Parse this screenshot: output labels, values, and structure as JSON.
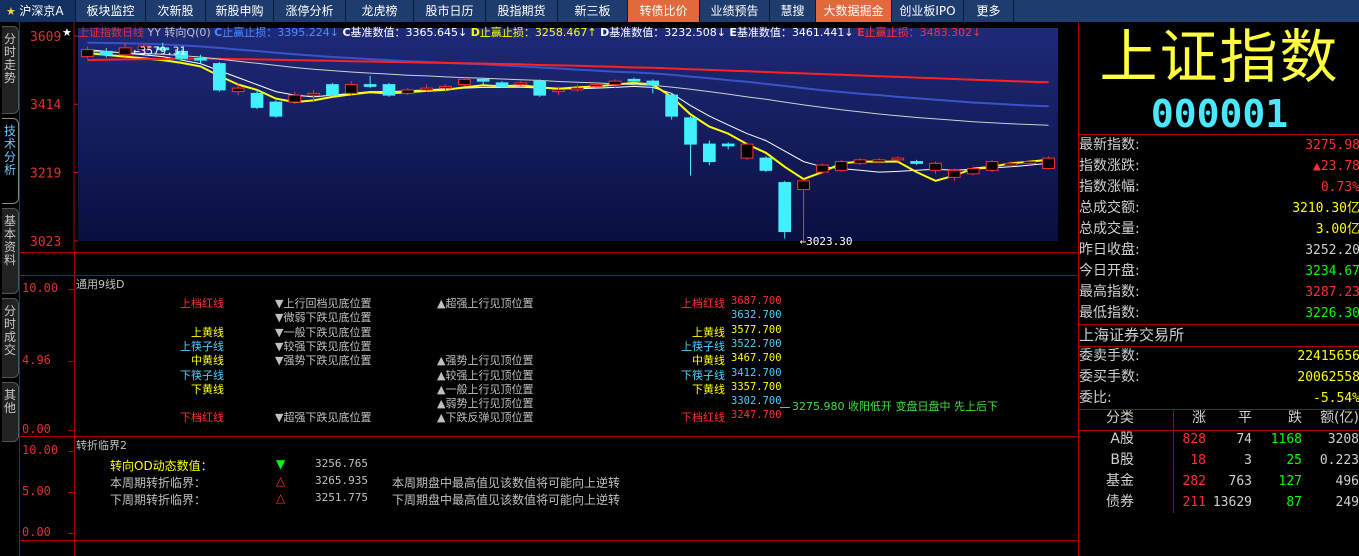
{
  "nav": {
    "tabs": [
      {
        "label": "沪深京A",
        "style": "home"
      },
      {
        "label": "板块监控",
        "style": "normal"
      },
      {
        "label": "次新股",
        "style": "normal"
      },
      {
        "label": "新股申购",
        "style": "normal"
      },
      {
        "label": "涨停分析",
        "style": "normal"
      },
      {
        "label": "龙虎榜",
        "style": "normal"
      },
      {
        "label": "股市日历",
        "style": "normal"
      },
      {
        "label": "股指期货",
        "style": "normal"
      },
      {
        "label": "新三板",
        "style": "normal"
      },
      {
        "label": "转债比价",
        "style": "orange"
      },
      {
        "label": "业绩预告",
        "style": "normal"
      },
      {
        "label": "慧搜",
        "style": "normal"
      },
      {
        "label": "大数据掘金",
        "style": "orange"
      },
      {
        "label": "创业板IPO",
        "style": "normal"
      },
      {
        "label": "更多",
        "style": "normal"
      }
    ]
  },
  "side_tabs": [
    {
      "label": "分时走势",
      "active": false
    },
    {
      "label": "技术分析",
      "active": true
    },
    {
      "label": "基本资料",
      "active": false
    },
    {
      "label": "分时成交",
      "active": false
    },
    {
      "label": "其他",
      "active": false
    }
  ],
  "chart_header": {
    "title": "上证指数日线",
    "mode": "YY 转向Q(0)",
    "items": [
      {
        "key": "C",
        "label": "止赢止损：",
        "value": "3395.224↓",
        "color": "#4a8cff"
      },
      {
        "key": "C",
        "label": "基准数值：",
        "value": "3365.645↓",
        "color": "#ffffff"
      },
      {
        "key": "D",
        "label": "止赢止损：",
        "value": "3258.467↑",
        "color": "#ffff00"
      },
      {
        "key": "D",
        "label": "基准数值：",
        "value": "3232.508↓",
        "color": "#ffffff"
      },
      {
        "key": "E",
        "label": "基准数值：",
        "value": "3461.441↓",
        "color": "#ffffff"
      },
      {
        "key": "E",
        "label": "止赢止损：",
        "value": "3483.302↓",
        "color": "#ff3030"
      }
    ]
  },
  "price_axis": [
    "3609",
    "3414",
    "3219",
    "3023"
  ],
  "annotations": {
    "high": "3579.31",
    "low": "3023.30"
  },
  "chart_data": {
    "type": "candlestick",
    "ylim": [
      3023,
      3609
    ],
    "candles": [
      {
        "o": 3550,
        "c": 3570,
        "h": 3579,
        "l": 3545
      },
      {
        "o": 3565,
        "c": 3555,
        "h": 3575,
        "l": 3548
      },
      {
        "o": 3555,
        "c": 3575,
        "h": 3590,
        "l": 3550
      },
      {
        "o": 3570,
        "c": 3580,
        "h": 3585,
        "l": 3560
      },
      {
        "o": 3575,
        "c": 3570,
        "h": 3590,
        "l": 3565
      },
      {
        "o": 3565,
        "c": 3545,
        "h": 3570,
        "l": 3540
      },
      {
        "o": 3545,
        "c": 3540,
        "h": 3555,
        "l": 3530
      },
      {
        "o": 3530,
        "c": 3455,
        "h": 3535,
        "l": 3450
      },
      {
        "o": 3450,
        "c": 3460,
        "h": 3475,
        "l": 3440
      },
      {
        "o": 3445,
        "c": 3405,
        "h": 3455,
        "l": 3400
      },
      {
        "o": 3420,
        "c": 3380,
        "h": 3425,
        "l": 3375
      },
      {
        "o": 3420,
        "c": 3440,
        "h": 3450,
        "l": 3415
      },
      {
        "o": 3440,
        "c": 3445,
        "h": 3455,
        "l": 3420
      },
      {
        "o": 3470,
        "c": 3440,
        "h": 3475,
        "l": 3435
      },
      {
        "o": 3445,
        "c": 3470,
        "h": 3480,
        "l": 3440
      },
      {
        "o": 3470,
        "c": 3465,
        "h": 3495,
        "l": 3460
      },
      {
        "o": 3470,
        "c": 3440,
        "h": 3475,
        "l": 3435
      },
      {
        "o": 3445,
        "c": 3455,
        "h": 3460,
        "l": 3440
      },
      {
        "o": 3455,
        "c": 3460,
        "h": 3470,
        "l": 3450
      },
      {
        "o": 3460,
        "c": 3465,
        "h": 3470,
        "l": 3450
      },
      {
        "o": 3470,
        "c": 3485,
        "h": 3490,
        "l": 3465
      },
      {
        "o": 3485,
        "c": 3480,
        "h": 3490,
        "l": 3470
      },
      {
        "o": 3475,
        "c": 3465,
        "h": 3480,
        "l": 3460
      },
      {
        "o": 3470,
        "c": 3475,
        "h": 3480,
        "l": 3465
      },
      {
        "o": 3480,
        "c": 3440,
        "h": 3485,
        "l": 3435
      },
      {
        "o": 3450,
        "c": 3455,
        "h": 3465,
        "l": 3440
      },
      {
        "o": 3455,
        "c": 3460,
        "h": 3470,
        "l": 3450
      },
      {
        "o": 3465,
        "c": 3470,
        "h": 3475,
        "l": 3460
      },
      {
        "o": 3470,
        "c": 3480,
        "h": 3485,
        "l": 3460
      },
      {
        "o": 3485,
        "c": 3480,
        "h": 3490,
        "l": 3470
      },
      {
        "o": 3480,
        "c": 3470,
        "h": 3485,
        "l": 3445
      },
      {
        "o": 3440,
        "c": 3380,
        "h": 3445,
        "l": 3370
      },
      {
        "o": 3375,
        "c": 3300,
        "h": 3380,
        "l": 3210
      },
      {
        "o": 3300,
        "c": 3250,
        "h": 3310,
        "l": 3240
      },
      {
        "o": 3300,
        "c": 3295,
        "h": 3305,
        "l": 3285
      },
      {
        "o": 3260,
        "c": 3300,
        "h": 3305,
        "l": 3255
      },
      {
        "o": 3260,
        "c": 3225,
        "h": 3265,
        "l": 3220
      },
      {
        "o": 3190,
        "c": 3050,
        "h": 3195,
        "l": 3030
      },
      {
        "o": 3170,
        "c": 3195,
        "h": 3200,
        "l": 3023
      },
      {
        "o": 3220,
        "c": 3240,
        "h": 3245,
        "l": 3215
      },
      {
        "o": 3225,
        "c": 3250,
        "h": 3255,
        "l": 3220
      },
      {
        "o": 3245,
        "c": 3255,
        "h": 3260,
        "l": 3240
      },
      {
        "o": 3250,
        "c": 3255,
        "h": 3260,
        "l": 3245
      },
      {
        "o": 3255,
        "c": 3260,
        "h": 3265,
        "l": 3250
      },
      {
        "o": 3250,
        "c": 3245,
        "h": 3255,
        "l": 3240
      },
      {
        "o": 3225,
        "c": 3245,
        "h": 3250,
        "l": 3215
      },
      {
        "o": 3205,
        "c": 3225,
        "h": 3230,
        "l": 3195
      },
      {
        "o": 3215,
        "c": 3230,
        "h": 3235,
        "l": 3210
      },
      {
        "o": 3225,
        "c": 3250,
        "h": 3255,
        "l": 3220
      },
      {
        "o": 3240,
        "c": 3245,
        "h": 3250,
        "l": 3235
      },
      {
        "o": 3245,
        "c": 3250,
        "h": 3255,
        "l": 3240
      },
      {
        "o": 3230,
        "c": 3260,
        "h": 3265,
        "l": 3228
      }
    ],
    "series": [
      {
        "color": "#ffffff",
        "width": 1,
        "values": [
          3570,
          3565,
          3560,
          3555,
          3550,
          3540,
          3530,
          3510,
          3490,
          3470,
          3450,
          3440,
          3435,
          3440,
          3445,
          3450,
          3450,
          3452,
          3455,
          3458,
          3460,
          3462,
          3462,
          3463,
          3460,
          3458,
          3458,
          3460,
          3462,
          3465,
          3462,
          3445,
          3410,
          3380,
          3355,
          3330,
          3310,
          3280,
          3250,
          3235,
          3230,
          3225,
          3220,
          3222,
          3225,
          3228,
          3225,
          3228,
          3232,
          3235,
          3240,
          3245
        ]
      },
      {
        "color": "#ffff00",
        "width": 2,
        "values": [
          3560,
          3555,
          3550,
          3545,
          3540,
          3532,
          3522,
          3495,
          3470,
          3455,
          3430,
          3420,
          3425,
          3435,
          3442,
          3448,
          3445,
          3448,
          3452,
          3455,
          3462,
          3468,
          3465,
          3468,
          3462,
          3458,
          3462,
          3465,
          3470,
          3475,
          3470,
          3435,
          3385,
          3350,
          3330,
          3300,
          3275,
          3235,
          3200,
          3220,
          3245,
          3250,
          3250,
          3250,
          3220,
          3195,
          3210,
          3230,
          3235,
          3245,
          3250,
          3255
        ]
      },
      {
        "color": "#3a52c8",
        "width": 2,
        "values": [
          3590,
          3589,
          3588,
          3587,
          3585,
          3582,
          3579,
          3575,
          3570,
          3566,
          3561,
          3557,
          3553,
          3549,
          3546,
          3543,
          3540,
          3537,
          3535,
          3532,
          3530,
          3528,
          3525,
          3522,
          3519,
          3516,
          3513,
          3510,
          3507,
          3505,
          3502,
          3498,
          3493,
          3488,
          3483,
          3478,
          3472,
          3466,
          3460,
          3454,
          3449,
          3444,
          3440,
          3435,
          3431,
          3427,
          3423,
          3419,
          3416,
          3413,
          3410,
          3408
        ]
      },
      {
        "color": "#ff2020",
        "width": 2,
        "values": [
          3540,
          3541,
          3542,
          3543,
          3543,
          3544,
          3544,
          3544,
          3543,
          3542,
          3541,
          3540,
          3539,
          3538,
          3537,
          3536,
          3535,
          3534,
          3533,
          3532,
          3531,
          3530,
          3529,
          3528,
          3526,
          3525,
          3524,
          3522,
          3521,
          3519,
          3518,
          3516,
          3514,
          3512,
          3510,
          3508,
          3506,
          3504,
          3502,
          3500,
          3498,
          3496,
          3494,
          3492,
          3490,
          3488,
          3486,
          3484,
          3482,
          3480,
          3478,
          3477
        ]
      },
      {
        "color": "#cfcfcf",
        "width": 1,
        "values": [
          3565,
          3563,
          3561,
          3559,
          3557,
          3553,
          3549,
          3543,
          3537,
          3531,
          3525,
          3519,
          3514,
          3510,
          3506,
          3503,
          3500,
          3497,
          3495,
          3492,
          3490,
          3488,
          3486,
          3484,
          3482,
          3479,
          3477,
          3475,
          3472,
          3470,
          3468,
          3463,
          3457,
          3450,
          3443,
          3435,
          3428,
          3420,
          3412,
          3405,
          3398,
          3392,
          3386,
          3381,
          3376,
          3372,
          3368,
          3364,
          3361,
          3358,
          3356,
          3354
        ]
      }
    ]
  },
  "panel1": {
    "title": "通用9线D",
    "axis": [
      "10.00",
      "4.96",
      "0.00"
    ],
    "rows": [
      {
        "left": "上档红线",
        "left_color": "#ff3030",
        "mid": "▼上行回档见底位置",
        "right": "▲超强上行见顶位置",
        "name": "上档红线",
        "name_color": "#ff3030",
        "value": "3687.700",
        "value_color": "#ff3030"
      },
      {
        "left": "",
        "left_color": "#ff3030",
        "mid": "▼微弱下跌见底位置",
        "right": "",
        "name": "",
        "name_color": "#ff3030",
        "value": "3632.700",
        "value_color": "#4ad0ff"
      },
      {
        "left": "上黄线",
        "left_color": "#ffff00",
        "mid": "▼一般下跌见底位置",
        "right": "",
        "name": "上黄线",
        "name_color": "#ffff00",
        "value": "3577.700",
        "value_color": "#ffff00"
      },
      {
        "left": "上筷子线",
        "left_color": "#4ad0ff",
        "mid": "▼较强下跌见底位置",
        "right": "",
        "name": "上筷子线",
        "name_color": "#4ad0ff",
        "value": "3522.700",
        "value_color": "#4ad0ff"
      },
      {
        "left": "中黄线",
        "left_color": "#ffff00",
        "mid": "▼强势下跌见底位置",
        "right": "▲强势上行见顶位置",
        "name": "中黄线",
        "name_color": "#ffff00",
        "value": "3467.700",
        "value_color": "#ffff00"
      },
      {
        "left": "下筷子线",
        "left_color": "#4ad0ff",
        "mid": "",
        "right": "▲较强上行见顶位置",
        "name": "下筷子线",
        "name_color": "#4ad0ff",
        "value": "3412.700",
        "value_color": "#4ad0ff"
      },
      {
        "left": "下黄线",
        "left_color": "#ffff00",
        "mid": "",
        "right": "▲一般上行见顶位置",
        "name": "下黄线",
        "name_color": "#ffff00",
        "value": "3357.700",
        "value_color": "#ffff00"
      },
      {
        "left": "",
        "left_color": "#ff3030",
        "mid": "",
        "right": "▲弱势上行见顶位置",
        "name": "",
        "name_color": "#ff3030",
        "value": "3302.700",
        "value_color": "#4ad0ff"
      },
      {
        "left": "下档红线",
        "left_color": "#ff3030",
        "mid": "▼超强下跌见底位置",
        "right": "▲下跌反弹见顶位置",
        "name": "下档红线",
        "name_color": "#ff3030",
        "value": "3247.700",
        "value_color": "#ff3030"
      }
    ],
    "note": "3275.980 收阳低开 变盘日盘中 先上后下"
  },
  "panel2": {
    "title": "转折临界2",
    "axis": [
      "10.00",
      "5.00",
      "0.00"
    ],
    "rows": [
      {
        "label": "转向OD动态数值：",
        "label_color": "#ffff00",
        "mark": "▼",
        "mark_color": "#00ff00",
        "value": "3256.765",
        "desc": ""
      },
      {
        "label": "本周期转折临界：",
        "label_color": "#c0c0c0",
        "mark": "△",
        "mark_color": "#ff3030",
        "value": "3265.935",
        "desc": "本周期盘中最高值见该数值将可能向上逆转"
      },
      {
        "label": "下周期转折临界：",
        "label_color": "#c0c0c0",
        "mark": "△",
        "mark_color": "#ff3030",
        "value": "3251.775",
        "desc": "下周期盘中最高值见该数值将可能向上逆转"
      }
    ]
  },
  "quote": {
    "name": "上证指数",
    "code": "000001",
    "stats": [
      {
        "label": "最新指数:",
        "value": "3275.98",
        "color": "#ff3030"
      },
      {
        "label": "指数涨跌:",
        "value": "▲23.78",
        "color": "#ff3030"
      },
      {
        "label": "指数涨幅:",
        "value": "0.73%",
        "color": "#ff3030"
      },
      {
        "label": "总成交额:",
        "value": "3210.30亿",
        "color": "#ffff00"
      },
      {
        "label": "总成交量:",
        "value": "3.00亿",
        "color": "#ffff00"
      },
      {
        "label": "昨日收盘:",
        "value": "3252.20",
        "color": "#d0d0d0"
      },
      {
        "label": "今日开盘:",
        "value": "3234.67",
        "color": "#00ff00"
      },
      {
        "label": "最高指数:",
        "value": "3287.23",
        "color": "#ff3030"
      },
      {
        "label": "最低指数:",
        "value": "3226.30",
        "color": "#00ff00"
      }
    ],
    "exchange": "上海证券交易所",
    "orders": [
      {
        "label": "委卖手数:",
        "value": "22415656",
        "color": "#ffff00"
      },
      {
        "label": "委买手数:",
        "value": "20062558",
        "color": "#ffff00"
      },
      {
        "label": "委比:",
        "value": "-5.54%",
        "color": "#ffff00"
      }
    ],
    "table": {
      "headers": [
        "分类",
        "涨",
        "平",
        "跌",
        "额(亿)"
      ],
      "rows": [
        {
          "cat": "A股",
          "up": "828",
          "flat": "74",
          "down": "1168",
          "amt": "3208"
        },
        {
          "cat": "B股",
          "up": "18",
          "flat": "3",
          "down": "25",
          "amt": "0.223"
        },
        {
          "cat": "基金",
          "up": "282",
          "flat": "763",
          "down": "127",
          "amt": "496"
        },
        {
          "cat": "债券",
          "up": "211",
          "flat": "13629",
          "down": "87",
          "amt": "249"
        }
      ]
    }
  }
}
